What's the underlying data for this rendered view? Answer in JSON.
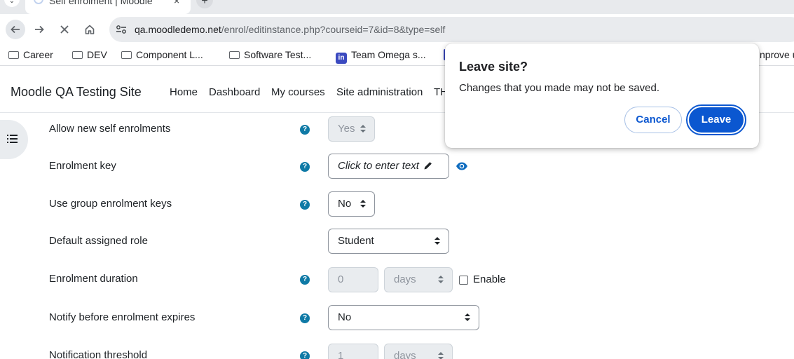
{
  "browser": {
    "tab_title": "Self enrolment | Moodle",
    "tab_close": "×",
    "new_tab": "+",
    "url_host": "qa.moodledemo.net",
    "url_path": "/enrol/editinstance.php?courseid=7&id=8&type=self",
    "bookmarks": [
      "Career",
      "DEV",
      "Component L...",
      "Software Test...",
      "Team Omega s...",
      "nprove u"
    ]
  },
  "moodle": {
    "site_name": "Moodle QA Testing Site",
    "nav": [
      "Home",
      "Dashboard",
      "My courses",
      "Site administration",
      "TH"
    ]
  },
  "form": {
    "allow_new_label": "Allow new self enrolments",
    "allow_new_value": "Yes",
    "enrolment_key_label": "Enrolment key",
    "enrolment_key_placeholder": "Click to enter text",
    "group_keys_label": "Use group enrolment keys",
    "group_keys_value": "No",
    "role_label": "Default assigned role",
    "role_value": "Student",
    "duration_label": "Enrolment duration",
    "duration_value": "0",
    "duration_unit": "days",
    "duration_enable": "Enable",
    "notify_label": "Notify before enrolment expires",
    "notify_value": "No",
    "threshold_label": "Notification threshold",
    "threshold_value": "1",
    "threshold_unit": "days",
    "help_glyph": "?"
  },
  "dialog": {
    "title": "Leave site?",
    "message": "Changes that you made may not be saved.",
    "cancel": "Cancel",
    "leave": "Leave"
  },
  "colors": {
    "accent": "#0b57d0",
    "help_icon": "#0f7aa6",
    "disabled_bg": "#e9ecef"
  }
}
